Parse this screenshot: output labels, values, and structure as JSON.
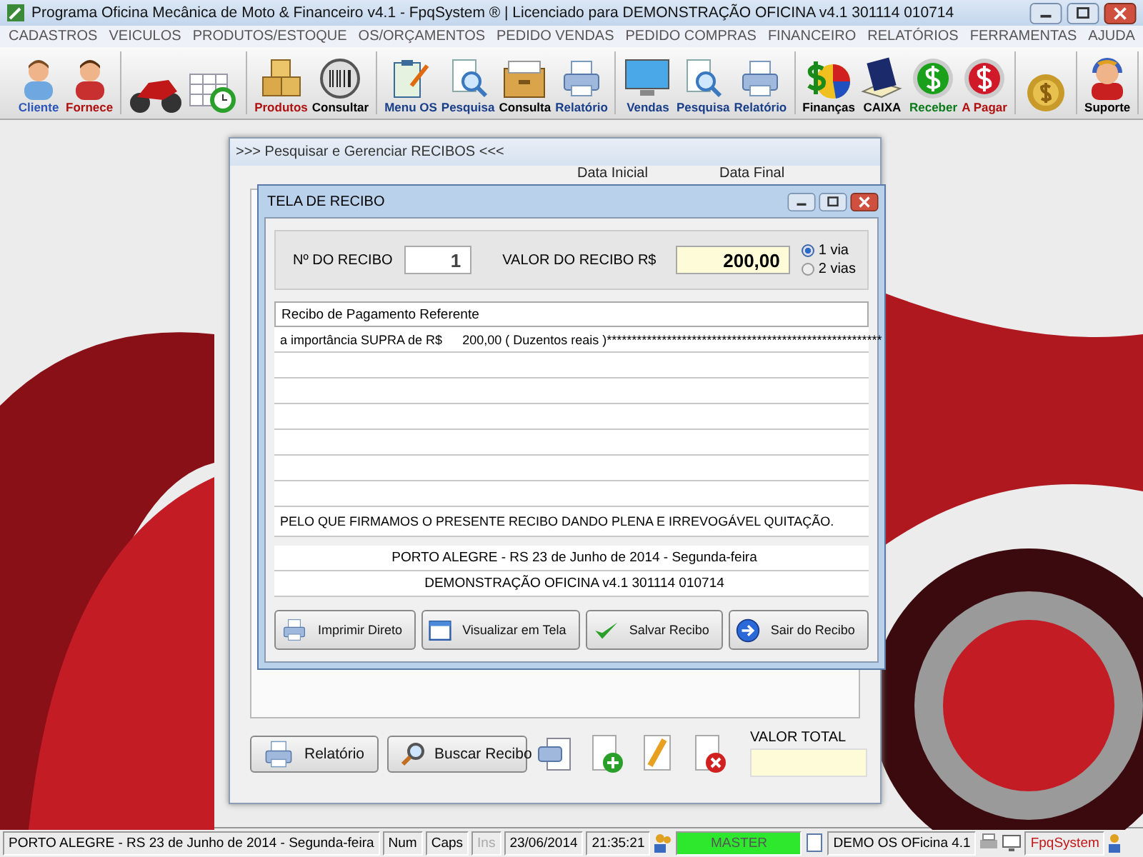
{
  "window": {
    "title": "Programa Oficina Mecânica de Moto & Financeiro v4.1 - FpqSystem ® | Licenciado para  DEMONSTRAÇÃO OFICINA v4.1 301114 010714"
  },
  "menu": [
    "CADASTROS",
    "VEICULOS",
    "PRODUTOS/ESTOQUE",
    "OS/ORÇAMENTOS",
    "PEDIDO VENDAS",
    "PEDIDO COMPRAS",
    "FINANCEIRO",
    "RELATÓRIOS",
    "FERRAMENTAS",
    "AJUDA"
  ],
  "toolbar": [
    {
      "label": "Cliente",
      "color": "#2a56b8"
    },
    {
      "label": "Fornece",
      "color": "#b01010"
    },
    {
      "label": "Produtos",
      "color": "#b01010"
    },
    {
      "label": "Consultar",
      "color": "#000000"
    },
    {
      "label": "Menu OS",
      "color": "#1a3f8a"
    },
    {
      "label": "Pesquisa",
      "color": "#1a3f8a"
    },
    {
      "label": "Consulta",
      "color": "#000000"
    },
    {
      "label": "Relatório",
      "color": "#1a3f8a"
    },
    {
      "label": "Vendas",
      "color": "#1a3f8a"
    },
    {
      "label": "Pesquisa",
      "color": "#1a3f8a"
    },
    {
      "label": "Relatório",
      "color": "#1a3f8a"
    },
    {
      "label": "Finanças",
      "color": "#000000"
    },
    {
      "label": "CAIXA",
      "color": "#000000"
    },
    {
      "label": "Receber",
      "color": "#0a7a1a"
    },
    {
      "label": "A Pagar",
      "color": "#b01010"
    },
    {
      "label": "Suporte",
      "color": "#000000"
    }
  ],
  "search_window": {
    "title": ">>>  Pesquisar e Gerenciar RECIBOS  <<<",
    "start_date_label": "Data Inicial",
    "end_date_label": "Data Final",
    "buttons": [
      {
        "label": "Relatório"
      },
      {
        "label": "Buscar Recibo"
      }
    ],
    "total_label": "VALOR TOTAL"
  },
  "receipt_dialog": {
    "title": "TELA DE RECIBO",
    "number_label": "Nº DO RECIBO",
    "number": "1",
    "amount_label": "VALOR DO RECIBO R$",
    "amount": "200,00",
    "copies": [
      {
        "label": "1 via",
        "selected": true
      },
      {
        "label": "2 vias",
        "selected": false
      }
    ],
    "reference_field": "Recibo de Pagamento Referente",
    "amount_line_label": "a importância SUPRA de R$",
    "amount_line_text": "200,00 ( Duzentos reais )*******************************************************",
    "closing_statement": "PELO QUE FIRMAMOS O PRESENTE RECIBO DANDO PLENA E IRREVOGÁVEL QUITAÇÃO.",
    "place_date": "PORTO ALEGRE - RS 23 de Junho de 2014 - Segunda-feira",
    "company": "DEMONSTRAÇÃO OFICINA v4.1 301114 010714",
    "buttons": [
      {
        "label": "Imprimir Direto"
      },
      {
        "label": "Visualizar em Tela"
      },
      {
        "label": "Salvar Recibo"
      },
      {
        "label": "Sair do Recibo"
      }
    ]
  },
  "status_bar": {
    "location": "PORTO ALEGRE - RS 23 de Junho de 2014 - Segunda-feira",
    "num": "Num",
    "caps": "Caps",
    "ins": {
      "text": "Ins",
      "disabled": true
    },
    "date": "23/06/2014",
    "time": "21:35:21",
    "user": "MASTER",
    "system": "DEMO OS OFicina 4.1",
    "brand": "FpqSystem"
  }
}
